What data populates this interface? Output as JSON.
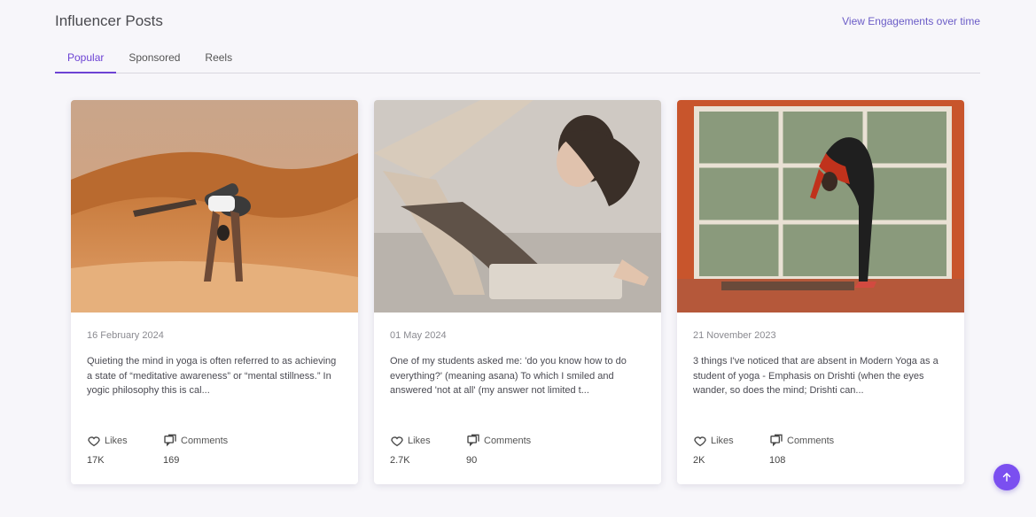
{
  "header": {
    "title": "Influencer Posts",
    "link": "View Engagements over time"
  },
  "tabs": [
    {
      "label": "Popular",
      "active": true
    },
    {
      "label": "Sponsored",
      "active": false
    },
    {
      "label": "Reels",
      "active": false
    }
  ],
  "posts": [
    {
      "date": "16 February 2024",
      "caption": "Quieting the mind in yoga is often referred to as achieving a state of “meditative awareness” or “mental stillness.” In yogic philosophy this is cal...",
      "likes_label": "Likes",
      "likes": "17K",
      "comments_label": "Comments",
      "comments": "169"
    },
    {
      "date": "01 May 2024",
      "caption": "One of my students asked me: 'do you know how to do everything?' (meaning asana) To which I smiled and answered 'not at all' (my answer not limited t...",
      "likes_label": "Likes",
      "likes": "2.7K",
      "comments_label": "Comments",
      "comments": "90"
    },
    {
      "date": "21 November 2023",
      "caption": "3 things I've noticed that are absent in Modern Yoga as a student of yoga - Emphasis on Drishti (when the eyes wander, so does the mind; Drishti can...",
      "likes_label": "Likes",
      "likes": "2K",
      "comments_label": "Comments",
      "comments": "108"
    }
  ],
  "icons": {
    "like": "heart-icon",
    "comment": "comment-icon",
    "scroll_top": "arrow-up-icon"
  },
  "colors": {
    "accent": "#6d43d4",
    "link": "#6b5cc7",
    "fab": "#7b4ff0"
  }
}
